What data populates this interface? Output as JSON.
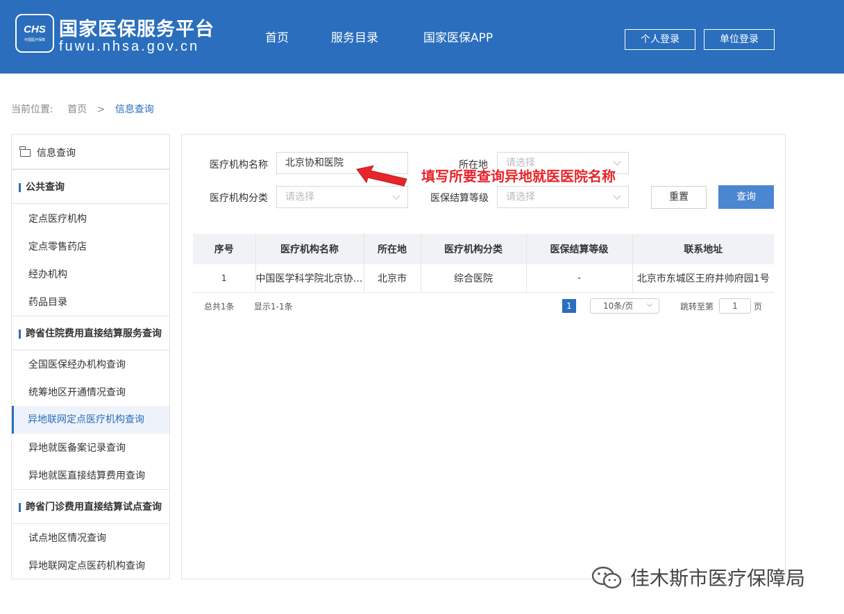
{
  "header": {
    "logo_text": "CHS",
    "logo_sub": "中国医疗保障",
    "title": "国家医保服务平台",
    "domain": "fuwu.nhsa.gov.cn",
    "nav": [
      "首页",
      "服务目录",
      "国家医保APP"
    ],
    "personal_login": "个人登录",
    "unit_login": "单位登录"
  },
  "breadcrumb": {
    "label": "当前位置:",
    "home": "首页",
    "separator": ">",
    "current": "信息查询"
  },
  "sidebar": {
    "top": "信息查询",
    "sections": [
      {
        "title": "公共查询",
        "items": [
          "定点医疗机构",
          "定点零售药店",
          "经办机构",
          "药品目录"
        ]
      },
      {
        "title": "跨省住院费用直接结算服务查询",
        "items": [
          "全国医保经办机构查询",
          "统筹地区开通情况查询",
          "异地联网定点医疗机构查询",
          "异地就医备案记录查询",
          "异地就医直接结算费用查询"
        ]
      },
      {
        "title": "跨省门诊费用直接结算试点查询",
        "items": [
          "试点地区情况查询",
          "异地联网定点医药机构查询"
        ]
      }
    ],
    "active_item": "异地联网定点医疗机构查询"
  },
  "form": {
    "name_label": "医疗机构名称",
    "name_value": "北京协和医院",
    "location_label": "所在地",
    "location_placeholder": "请选择",
    "category_label": "医疗机构分类",
    "category_placeholder": "请选择",
    "level_label": "医保结算等级",
    "level_placeholder": "请选择",
    "reset_label": "重置",
    "query_label": "查询"
  },
  "annotation": "填写所要查询异地就医医院名称",
  "table": {
    "headers": [
      "序号",
      "医疗机构名称",
      "所在地",
      "医疗机构分类",
      "医保结算等级",
      "联系地址"
    ],
    "rows": [
      [
        "1",
        "中国医学科学院北京协和医院",
        "北京市",
        "综合医院",
        "-",
        "北京市东城区王府井帅府园1号"
      ]
    ]
  },
  "pager": {
    "total": "总共1条",
    "showing": "显示1-1条",
    "current_page": "1",
    "page_size": "10条/页",
    "jump_label": "跳转至第",
    "jump_value": "1",
    "jump_suffix": "页"
  },
  "watermark": "佳木斯市医疗保障局",
  "colors": {
    "header_bg": "#2a6ebd",
    "accent": "#2a6ebd",
    "query_button": "#4b86d1",
    "annotation": "#e8252b"
  }
}
